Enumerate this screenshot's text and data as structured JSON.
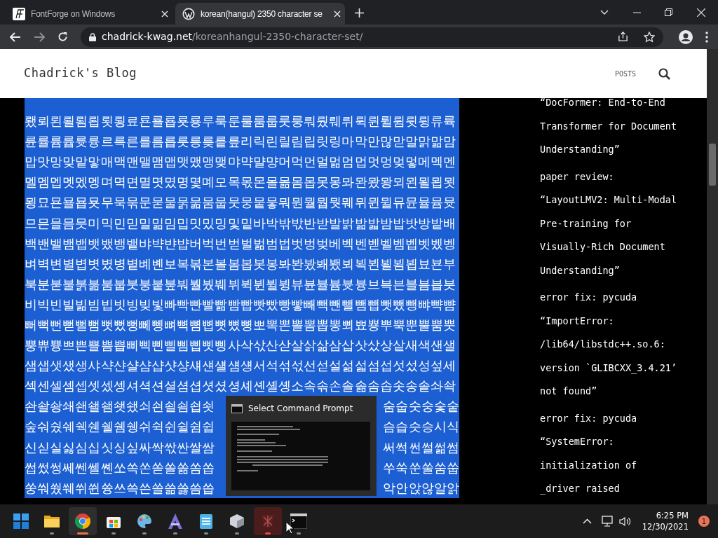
{
  "browser": {
    "tabs": [
      {
        "title": "FontForge on Windows",
        "selected": false
      },
      {
        "title": "korean(hangul) 2350 character se",
        "selected": true
      }
    ],
    "url": {
      "domain": "chadrick-kwag.net",
      "path": "/koreanhangul-2350-character-set/"
    }
  },
  "blog": {
    "title": "Chadrick's Blog",
    "nav": [
      "POSTS"
    ]
  },
  "content": {
    "selected": true,
    "lines": [
      {
        "text": "뢨뢰뢴뢸룀룁룃룅료룐룔룝룟룡루룩룬룰룸룹룻룽뤄뤘뤠뤼뤽륀륄륌륏륑류륙"
      },
      {
        "text": "륜률륨륩륫륭르륵른를름릅릇릉릊릍릎리릭린릴림립릿링마막만많맏말맑맒맘"
      },
      {
        "text": "맙맛망맞맡맣매맥맨맬맴맵맷맸맹맺먀먁먈먕머먹먼멀멂멈멉멋멍멎멓메멕멘"
      },
      {
        "text": "멜멤멥멧멨멩며멱면멸몃몄명몇몌모목몫몬몰몲몸몹못몽뫄뫈뫘뫙뫼묀묄묍묏"
      },
      {
        "text": "묑묘묜묠묩묫무묵묶문묻물묽묾뭄뭅뭇뭉뭍뭏뭐뭔뭘뭡뭣뭬뮈뮌뮐뮤뮨뮬뮴뮷"
      },
      {
        "text": "므믄믈믐믓미믹민믿밀밂밈밉밋밌밍및밑바박밖밗반받발밝밞밟밤밥밧방밭배"
      },
      {
        "text": "백밴밸뱀뱁뱃뱄뱅뱉뱌뱍뱐뱝버벅번벋벌벎범법벗벙벚베벡벤벧벨벰벱벳벴벵"
      },
      {
        "text": "벼벽변별볍볏볐병볕볘볜보복볶본볼봄봅봇봉봐봔봤봬뵀뵈뵉뵌뵐뵘뵙뵤뵨부"
      },
      {
        "text": "북분붇불붉붊붐붑붓붕붙붚붜붤붰붸뷔뷕뷘뷜뷩뷰뷴뷸븀븃븅브븍븐블븜븝븟"
      },
      {
        "text": "비빅빈빌빎빔빕빗빙빚빛빠빡빤빨빪빰빱빳빴빵빻빼빽뺀뺄뺌뺍뺏뺐뺑뺘뺙뺨"
      },
      {
        "text": "뻐뻑뻔뻗뻘뻠뻣뻤뻥뻬뼁뼈뼉뼘뼙뼛뼜뼝뽀뽁뽄뽈뽐뽑뽕뾔뾰뿅뿌뿍뿐뿔뿜뿟"
      },
      {
        "text": "뿡쀼쁑쁘쁜쁠쁨쁩삐삑삔삘삠삡삣삥사삭삯산삳살삵삶삼삽삿샀상샅새색샌샐"
      },
      {
        "text": "샘샙샛샜생샤샥샨샬샴샵샷샹섀섄섈섐섕서석섞섟선섣설섦섧섬섭섯섰성섶세"
      },
      {
        "text": "섹센셀셈셉셋셌셍셔셕션셜셤셥셧셨셩셰셴셸솅소속솎손솔솖솜솝솟송솥솨솩"
      },
      {
        "left": "솬솰솽쇄쇈쇌쇔쇗쇘쇠쇤쇨쇰쇱쇳",
        "right": "숨숩숫숭숯숱"
      },
      {
        "left": "숲숴쉈쉐쉑쉔쉘쉠쉥쉬쉭쉰쉴쉼쉽",
        "right": "슴습슷승시식"
      },
      {
        "left": "신싣실싫심십싯싱싶싸싹싻싼쌀쌈",
        "right": "써썩썬썰썲썸"
      },
      {
        "left": "썹썼썽쎄쎈쎌쏀쏘쏙쏜쏟쏠쏢쏨쏩",
        "right": "쑤쑥쑨쑬쑴쑵"
      },
      {
        "left": "쑹쒀쒔쒜쒸쒼쓩쓰쓱쓴쓸쓺쓿씀씁",
        "right": "악안앉않알앍"
      }
    ]
  },
  "sidebar": {
    "posts": [
      {
        "lines": [
          "“DocFormer: End-to-End",
          "Transformer for Document",
          "Understanding”"
        ]
      },
      {
        "lines": [
          "paper review:",
          "“LayoutLMV2: Multi-Modal",
          "Pre-training for",
          "Visually-Rich Document",
          "Understanding”"
        ]
      },
      {
        "lines": [
          "error fix: pycuda",
          "“ImportError:",
          "/lib64/libstdc++.so.6:",
          "version `GLIBCXX_3.4.21’",
          "not found”"
        ]
      },
      {
        "lines": [
          "error fix: pycuda",
          "“SystemError:",
          "initialization of",
          "_driver raised"
        ]
      }
    ]
  },
  "taskbar_preview": {
    "title": "Select Command Prompt"
  },
  "taskbar": {
    "apps": [
      {
        "kind": "start",
        "open": false,
        "active": false,
        "attention": false
      },
      {
        "kind": "folder",
        "open": true,
        "active": false,
        "attention": false
      },
      {
        "kind": "chrome",
        "open": true,
        "active": true,
        "attention": false
      },
      {
        "kind": "store",
        "open": true,
        "active": false,
        "attention": false
      },
      {
        "kind": "paint",
        "open": true,
        "active": false,
        "attention": false
      },
      {
        "kind": "font",
        "open": true,
        "active": false,
        "attention": false
      },
      {
        "kind": "notepad",
        "open": true,
        "active": false,
        "attention": false
      },
      {
        "kind": "cube",
        "open": true,
        "active": false,
        "attention": false
      },
      {
        "kind": "fontforge",
        "open": true,
        "active": false,
        "attention": true
      },
      {
        "kind": "terminal",
        "open": true,
        "active": false,
        "attention": false
      }
    ],
    "clock": {
      "time": "6:25 PM",
      "date": "12/30/2021"
    },
    "notifications": "1"
  }
}
